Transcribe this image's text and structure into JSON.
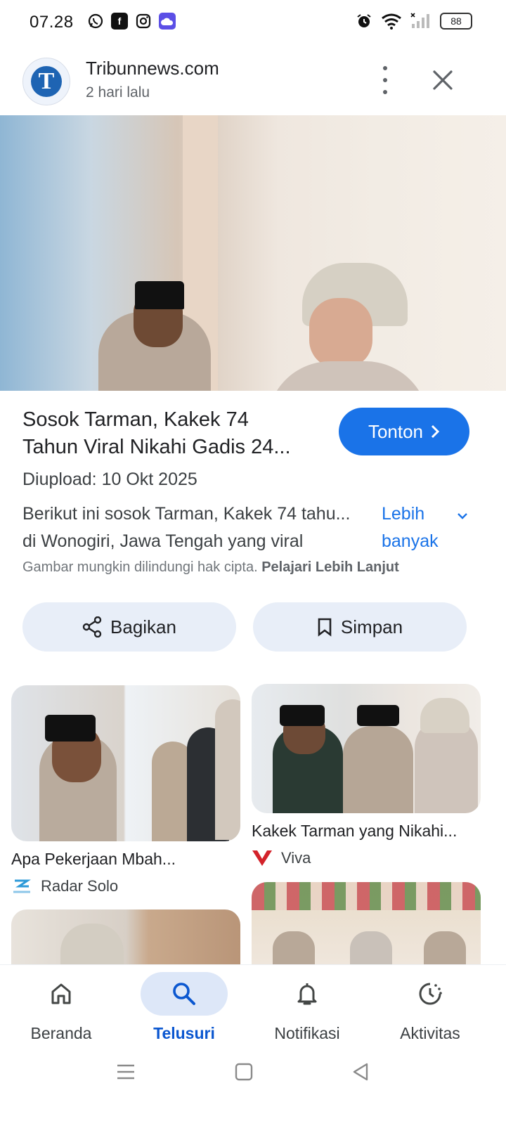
{
  "status_bar": {
    "time": "07.28",
    "battery": "88"
  },
  "header": {
    "site_name": "Tribunnews.com",
    "time_ago": "2 hari lalu",
    "logo_letter": "T"
  },
  "result": {
    "title_line1": "Sosok Tarman, Kakek 74",
    "title_line2": "Tahun Viral Nikahi Gadis 24...",
    "watch_label": "Tonton",
    "upload": "Diupload: 10 Okt 2025",
    "desc_line1": "Berikut ini sosok Tarman, Kakek 74 tahu...",
    "desc_line2": "di Wonogiri, Jawa Tengah yang viral",
    "more_line1": "Lebih",
    "more_line2": "banyak",
    "copyright_text": "Gambar mungkin dilindungi hak cipta.",
    "copyright_link": "Pelajari Lebih Lanjut",
    "share_label": "Bagikan",
    "save_label": "Simpan"
  },
  "related": [
    {
      "title": "Apa Pekerjaan Mbah...",
      "source": "Radar Solo"
    },
    {
      "title": "Kakek Tarman yang Nikahi...",
      "source": "Viva"
    }
  ],
  "bottom_nav": [
    {
      "label": "Beranda",
      "icon": "home-icon"
    },
    {
      "label": "Telusuri",
      "icon": "search-icon",
      "active": true
    },
    {
      "label": "Notifikasi",
      "icon": "bell-icon"
    },
    {
      "label": "Aktivitas",
      "icon": "activity-icon"
    }
  ],
  "colors": {
    "accent": "#1a73e8",
    "active_nav": "#0b57d0",
    "chip_bg": "#e8eef8"
  }
}
